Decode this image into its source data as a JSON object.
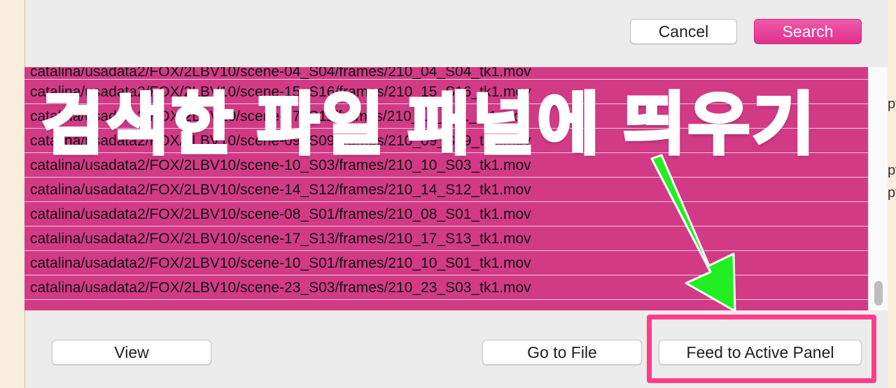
{
  "toolbar": {
    "cancel_label": "Cancel",
    "search_label": "Search"
  },
  "results": [
    "catalina/usadata2/FOX/2LBV10/scene-04_S04/frames/210_04_S04_tk1.mov",
    "catalina/usadata2/FOX/2LBV10/scene-15_S16/frames/210_15_S16_tk1.mov",
    "catalina/usadata2/FOX/2LBV10/scene-17_S11/frames/210_17_S11_tk1.mov",
    "catalina/usadata2/FOX/2LBV10/scene-09_S09/frames/210_09_S09_tk1.mov",
    "catalina/usadata2/FOX/2LBV10/scene-10_S03/frames/210_10_S03_tk1.mov",
    "catalina/usadata2/FOX/2LBV10/scene-14_S12/frames/210_14_S12_tk1.mov",
    "catalina/usadata2/FOX/2LBV10/scene-08_S01/frames/210_08_S01_tk1.mov",
    "catalina/usadata2/FOX/2LBV10/scene-17_S13/frames/210_17_S13_tk1.mov",
    "catalina/usadata2/FOX/2LBV10/scene-10_S01/frames/210_10_S01_tk1.mov",
    "catalina/usadata2/FOX/2LBV10/scene-23_S03/frames/210_23_S03_tk1.mov"
  ],
  "footer": {
    "view_label": "View",
    "go_to_file_label": "Go to File",
    "feed_label": "Feed to Active Panel"
  },
  "annotation": {
    "title": "검색한 파일 패널에 띄우기"
  },
  "side_clipped": [
    "py",
    "py",
    "py"
  ],
  "colors": {
    "accent": "#e2308c",
    "list_bg": "#d33a86",
    "annotation": "#ff3d8b",
    "arrow": "#22ee22"
  }
}
